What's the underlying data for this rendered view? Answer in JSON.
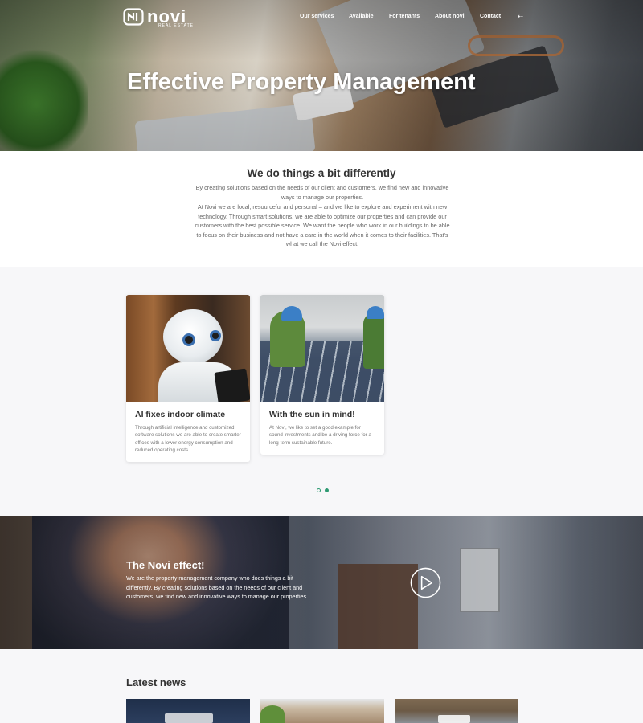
{
  "brand": {
    "name": "novi",
    "tagline": "REAL ESTATE"
  },
  "nav": {
    "items": [
      "Our services",
      "Available",
      "For tenants",
      "About novi",
      "Contact"
    ],
    "lang_icon": "arrow-left-icon"
  },
  "hero": {
    "title": "Effective Property Management"
  },
  "intro": {
    "heading": "We do things a bit differently",
    "p1": "By creating solutions based on the needs of our client and customers, we find new and innovative ways to manage our properties.",
    "p2": "At Novi we are local, resourceful and personal – and we like to explore and experiment with new technology. Through smart solutions, we are able to optimize our properties and can provide our customers with the best possible service. We want the people who work in our buildings to be able to focus on their business and not have a care in the world when it comes to their facilities. That's what we call the Novi effect."
  },
  "cards": [
    {
      "title": "AI fixes indoor climate",
      "text": "Through artificial intelligence and customized software solutions we are able to create smarter offices with a lower energy consumption and reduced operating costs"
    },
    {
      "title": "With the sun in mind!",
      "text": "At Novi, we like to set a good example for sound investments and be a driving force for a long-term sustainable future."
    }
  ],
  "carousel": {
    "active_index": 1,
    "count": 2
  },
  "video": {
    "heading": "The Novi effect!",
    "text": "We are the property management company who does things a bit differently. By creating solutions based on the needs of our client and customers, we find new and innovative ways to manage our properties.",
    "play_icon": "play-icon"
  },
  "news": {
    "heading": "Latest news"
  },
  "colors": {
    "accent": "#2e9a72",
    "text": "#333333",
    "muted": "#666666",
    "section_bg": "#f7f7f9"
  }
}
